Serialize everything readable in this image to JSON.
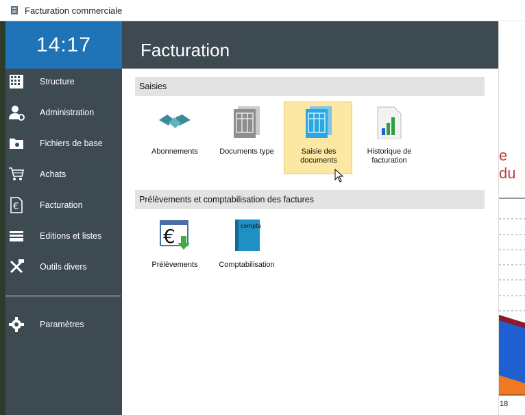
{
  "window": {
    "title": "Facturation commerciale"
  },
  "sidebar": {
    "clock": "14:17",
    "items": [
      {
        "label": "Structure",
        "icon": "building-grid-icon"
      },
      {
        "label": "Administration",
        "icon": "user-settings-icon"
      },
      {
        "label": "Fichiers de base",
        "icon": "folder-icon"
      },
      {
        "label": "Achats",
        "icon": "cart-icon"
      },
      {
        "label": "Facturation",
        "icon": "euro-document-icon"
      },
      {
        "label": "Editions et listes",
        "icon": "printer-stack-icon"
      },
      {
        "label": "Outils divers",
        "icon": "tools-icon"
      },
      {
        "label": "Paramètres",
        "icon": "gear-icon"
      }
    ]
  },
  "main": {
    "title": "Facturation",
    "sections": [
      {
        "label": "Saisies",
        "tiles": [
          {
            "label": "Abonnements",
            "icon": "handshake-icon",
            "selected": false
          },
          {
            "label": "Documents type",
            "icon": "document-template-icon",
            "selected": false
          },
          {
            "label": "Saisie des documents",
            "icon": "document-entry-icon",
            "selected": true
          },
          {
            "label": "Historique de facturation",
            "icon": "chart-report-icon",
            "selected": false
          }
        ]
      },
      {
        "label": "Prélèvements et comptabilisation des factures",
        "tiles": [
          {
            "label": "Prélèvements",
            "icon": "euro-download-icon",
            "selected": false
          },
          {
            "label": "Comptabilisation",
            "icon": "compta-book-icon",
            "selected": false
          }
        ]
      }
    ]
  },
  "background": {
    "partial_text": "e du",
    "partial_axis": "18"
  },
  "colors": {
    "sidebar": "#3d4a52",
    "clock_bg": "#1f73b7",
    "selected_tile": "#fce7a3"
  }
}
